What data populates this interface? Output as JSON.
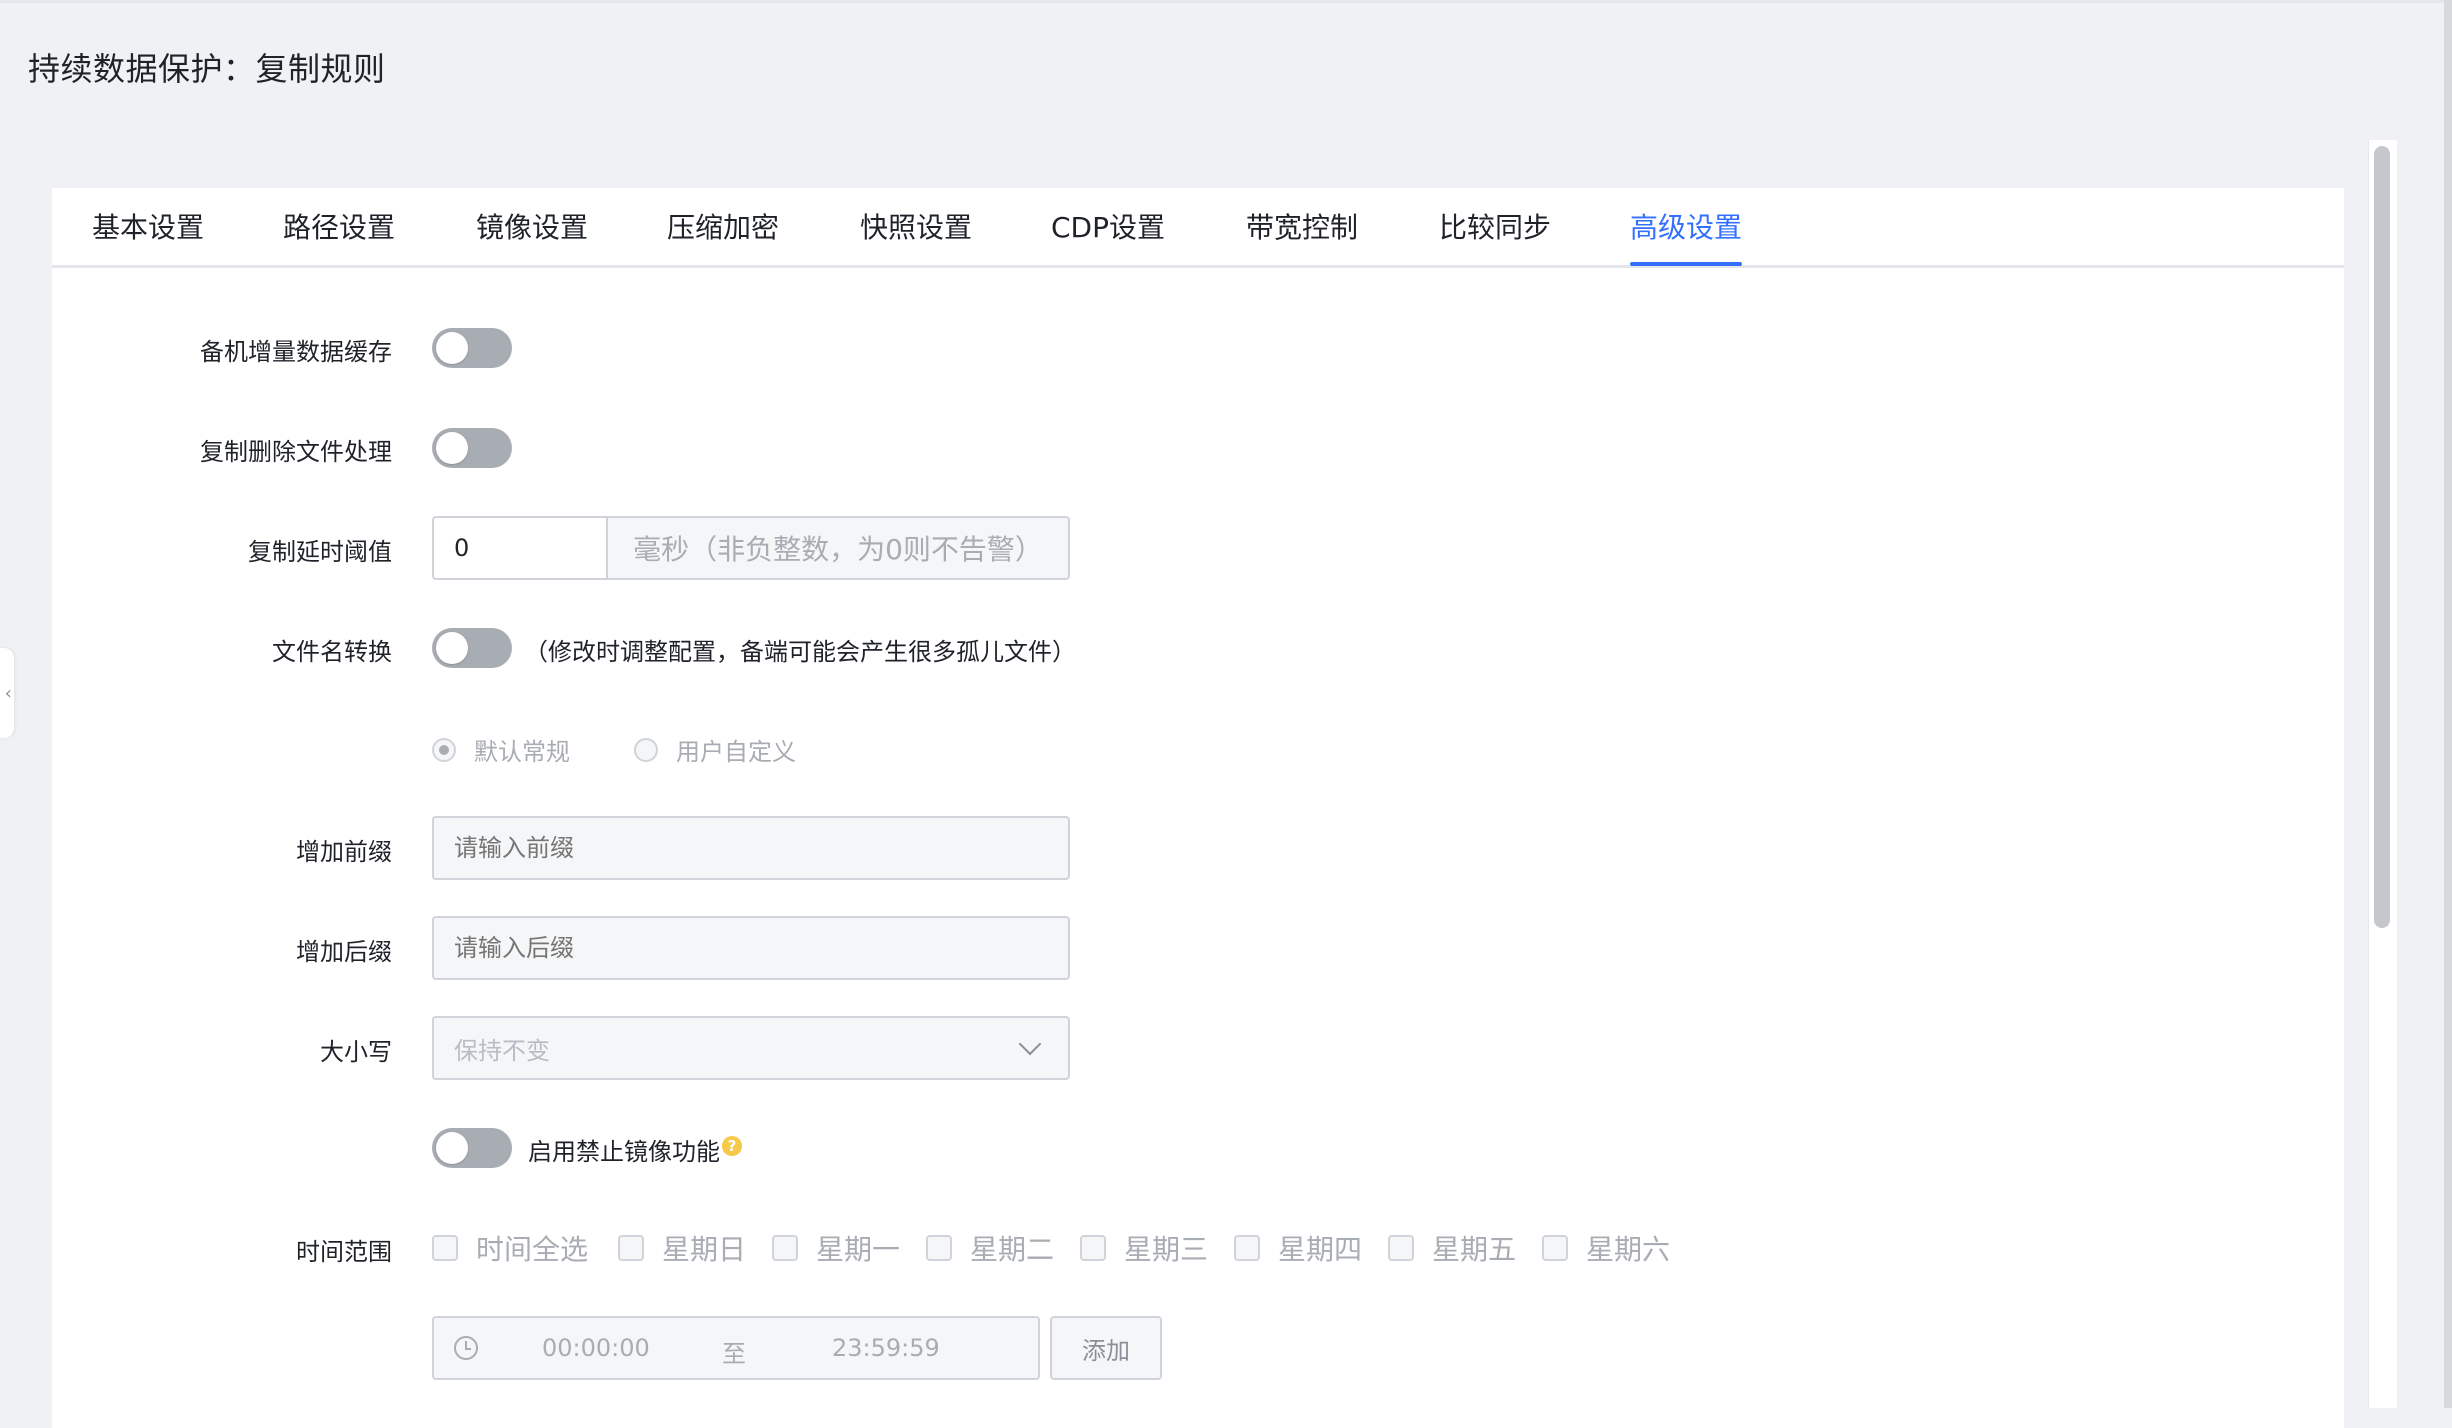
{
  "page": {
    "title": "持续数据保护：复制规则"
  },
  "tabs": [
    {
      "label": "基本设置"
    },
    {
      "label": "路径设置"
    },
    {
      "label": "镜像设置"
    },
    {
      "label": "压缩加密"
    },
    {
      "label": "快照设置"
    },
    {
      "label": "CDP设置"
    },
    {
      "label": "带宽控制"
    },
    {
      "label": "比较同步"
    },
    {
      "label": "高级设置",
      "active": true
    }
  ],
  "form": {
    "standby_cache": {
      "label": "备机增量数据缓存",
      "enabled": false
    },
    "delete_handling": {
      "label": "复制删除文件处理",
      "enabled": false
    },
    "delay_threshold": {
      "label": "复制延时阈值",
      "value": "0",
      "unit_hint": "毫秒（非负整数，为0则不告警）"
    },
    "filename_convert": {
      "label": "文件名转换",
      "enabled": false,
      "note": "（修改时调整配置，备端可能会产生很多孤儿文件）"
    },
    "convert_mode": {
      "options": [
        {
          "label": "默认常规",
          "checked": true
        },
        {
          "label": "用户自定义",
          "checked": false
        }
      ]
    },
    "prefix": {
      "label": "增加前缀",
      "placeholder": "请输入前缀"
    },
    "suffix": {
      "label": "增加后缀",
      "placeholder": "请输入后缀"
    },
    "letter_case": {
      "label": "大小写",
      "selected": "保持不变"
    },
    "disable_mirror": {
      "label": "启用禁止镜像功能",
      "enabled": false,
      "help_glyph": "?"
    },
    "time_range": {
      "label": "时间范围",
      "options": [
        {
          "label": "时间全选"
        },
        {
          "label": "星期日"
        },
        {
          "label": "星期一"
        },
        {
          "label": "星期二"
        },
        {
          "label": "星期三"
        },
        {
          "label": "星期四"
        },
        {
          "label": "星期五"
        },
        {
          "label": "星期六"
        }
      ],
      "start": "00:00:00",
      "separator": "至",
      "end": "23:59:59",
      "add_button": "添加"
    }
  },
  "colors": {
    "accent": "#3370ff",
    "switch_off": "#a8acb3",
    "help_icon": "#f7c948"
  },
  "icons": {
    "collapse": "chevron-left-icon",
    "select": "chevron-down-icon",
    "clock": "clock-icon",
    "help": "help-icon"
  }
}
